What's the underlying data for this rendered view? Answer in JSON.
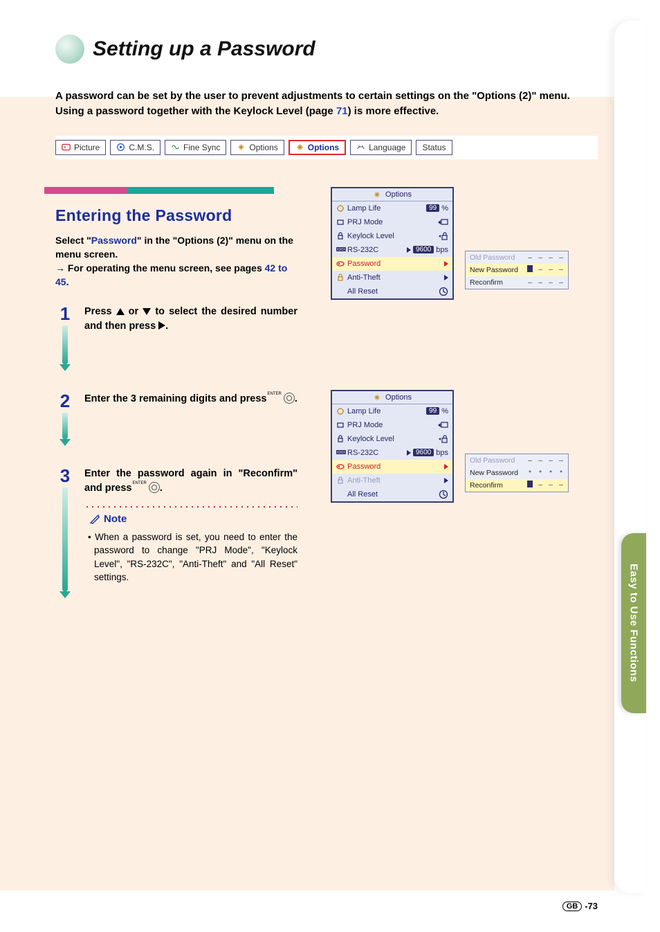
{
  "page": {
    "title": "Setting up a Password",
    "intro_a": "A password can be set by the user to prevent adjustments to certain settings on the \"Options (2)\" menu. Using a password together with the Keylock Level (page ",
    "intro_pg": "71",
    "intro_b": ") is more effective.",
    "side_tab": "Easy to Use Functions",
    "footer_region": "GB",
    "footer_page": "-73"
  },
  "tabs": [
    {
      "label": "Picture",
      "icon": "picture-icon"
    },
    {
      "label": "C.M.S.",
      "icon": "cms-icon"
    },
    {
      "label": "Fine Sync",
      "icon": "finesync-icon"
    },
    {
      "label": "Options",
      "icon": "options-icon"
    },
    {
      "label": "Options",
      "icon": "options-icon",
      "active": true
    },
    {
      "label": "Language",
      "icon": "language-icon"
    },
    {
      "label": "Status",
      "icon": ""
    }
  ],
  "section": {
    "title": "Entering the Password",
    "lead_a": "Select \"",
    "lead_hl": "Password",
    "lead_b": "\" in the \"Options (2)\" menu on the menu screen.",
    "lead_c": "→ For operating the menu screen, see pages ",
    "lead_pg": "42 to 45",
    "lead_d": "."
  },
  "steps": {
    "s1": "Press ▲ or ▼ to select the desired number and then press ▶.",
    "s2": "Enter the 3 remaining digits and press ",
    "s3a": "Enter the password again in \"Reconfirm\" and press ",
    "note_title": "Note",
    "note_body": "• When a password is set, you need to enter the password to change \"PRJ Mode\", \"Keylock Level\", \"RS-232C\", \"Anti-Theft\" and \"All Reset\" settings."
  },
  "osd": {
    "title": "Options",
    "items": [
      {
        "label": "Lamp Life",
        "right_badge": "99",
        "right_text": "%"
      },
      {
        "label": "PRJ Mode",
        "right_glyph": "prj"
      },
      {
        "label": "Keylock Level",
        "right_glyph": "lock"
      },
      {
        "label": "RS-232C",
        "right_badge": "9600",
        "right_text": "bps",
        "arrow": true
      },
      {
        "label": "Password",
        "selected": true,
        "arrow": true
      },
      {
        "label": "Anti-Theft",
        "arrow": true
      },
      {
        "label": "All Reset",
        "right_glyph": "reset"
      }
    ],
    "items2": [
      {
        "label": "Lamp Life",
        "right_badge": "99",
        "right_text": "%"
      },
      {
        "label": "PRJ Mode",
        "right_glyph": "prj"
      },
      {
        "label": "Keylock Level",
        "right_glyph": "lock"
      },
      {
        "label": "RS-232C",
        "right_badge": "9600",
        "right_text": "bps",
        "arrow": true
      },
      {
        "label": "Password",
        "selected": true,
        "arrow": true
      },
      {
        "label": "Anti-Theft",
        "dim": true,
        "arrow": true
      },
      {
        "label": "All Reset",
        "right_glyph": "reset"
      }
    ]
  },
  "pw1": {
    "rows": [
      {
        "label": "Old Password",
        "cells": [
          "–",
          "–",
          "–",
          "–"
        ],
        "dim": true
      },
      {
        "label": "New Password",
        "cells": [
          "■",
          "–",
          "–",
          "–"
        ],
        "hl": true
      },
      {
        "label": "Reconfirm",
        "cells": [
          "–",
          "–",
          "–",
          "–"
        ]
      }
    ]
  },
  "pw2": {
    "rows": [
      {
        "label": "Old Password",
        "cells": [
          "–",
          "–",
          "–",
          "–"
        ],
        "dim": true
      },
      {
        "label": "New Password",
        "cells": [
          "*",
          "*",
          "*",
          "*"
        ]
      },
      {
        "label": "Reconfirm",
        "cells": [
          "■",
          "–",
          "–",
          "–"
        ],
        "hl": true
      }
    ]
  }
}
